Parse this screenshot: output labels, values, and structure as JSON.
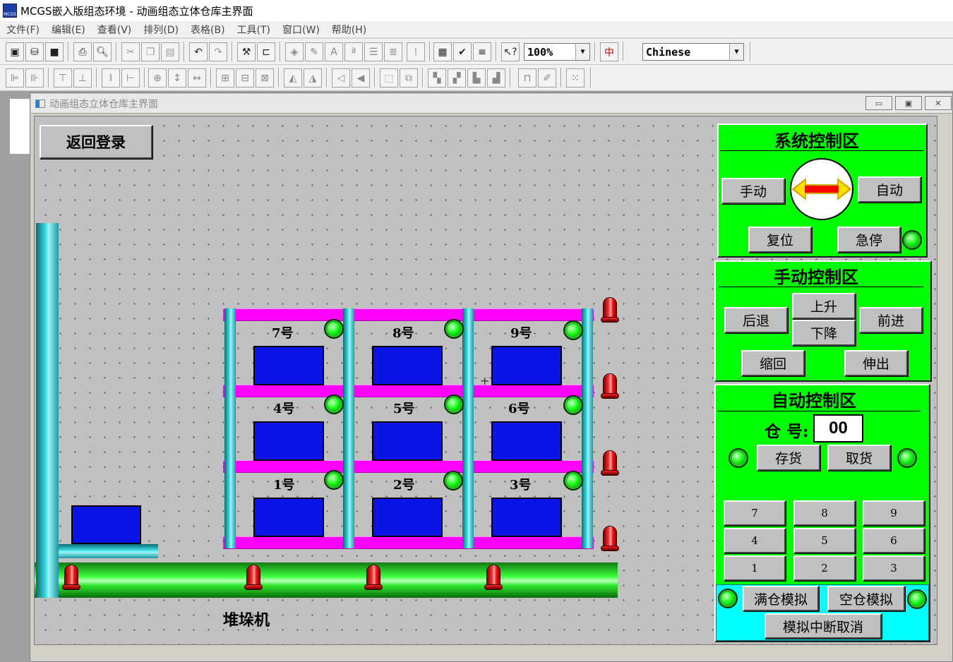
{
  "app": {
    "title": "MCGS嵌入版组态环境 - 动画组态立体仓库主界面",
    "icon_text": "MCGS"
  },
  "menu": [
    "文件(F)",
    "编辑(E)",
    "查看(V)",
    "排列(D)",
    "表格(B)",
    "工具(T)",
    "窗口(W)",
    "帮助(H)"
  ],
  "toolbar": {
    "zoom": "100%",
    "language": "Chinese"
  },
  "window": {
    "title": "动画组态立体仓库主界面",
    "controls": [
      "minimize",
      "restore",
      "close"
    ]
  },
  "canvas": {
    "back_button": "返回登录",
    "stacker_label": "堆垛机",
    "slots": [
      "7号",
      "8号",
      "9号",
      "4号",
      "5号",
      "6号",
      "1号",
      "2号",
      "3号"
    ]
  },
  "system_panel": {
    "title": "系统控制区",
    "manual": "手动",
    "auto": "自动",
    "reset": "复位",
    "estop": "急停"
  },
  "manual_panel": {
    "title": "手动控制区",
    "back": "后退",
    "up": "上升",
    "down": "下降",
    "forward": "前进",
    "retract": "缩回",
    "extend": "伸出"
  },
  "auto_panel": {
    "title": "自动控制区",
    "warehouse_label": "仓 号:",
    "warehouse_value": "00",
    "store": "存货",
    "retrieve": "取货",
    "keypad": [
      "7",
      "8",
      "9",
      "4",
      "5",
      "6",
      "1",
      "2",
      "3"
    ],
    "full_sim": "满仓模拟",
    "empty_sim": "空仓模拟",
    "cancel_sim": "模拟中断取消"
  },
  "colors": {
    "panel": "#00ff00",
    "sim_panel": "#00ffff",
    "shelf": "#ff00ff",
    "box": "#0a14e6",
    "pipe": "#3fe0e8",
    "canvas": "#c0c0c0"
  }
}
